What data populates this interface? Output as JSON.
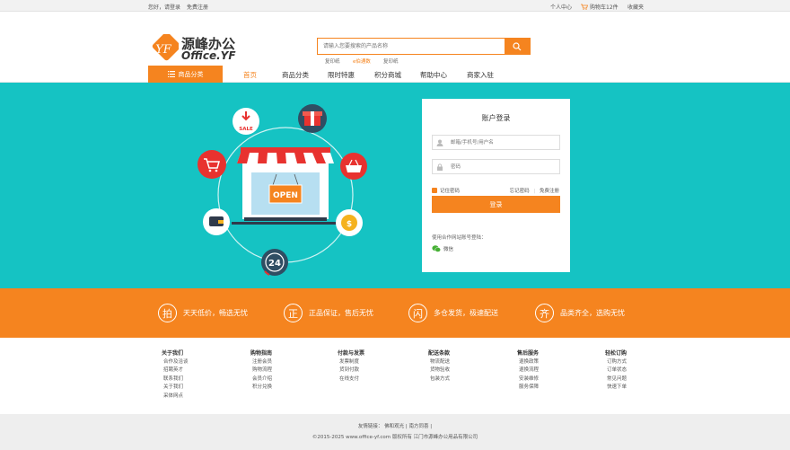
{
  "topbar": {
    "greeting": "您好，请登录",
    "register": "免费注册",
    "user_center": "个人中心",
    "cart": "购物车12件",
    "favorites": "收藏夹"
  },
  "logo": {
    "cn": "源峰办公",
    "en": "Office.YF"
  },
  "search": {
    "placeholder": "请输入您要搜索的产品名称",
    "hot": [
      "复印纸",
      "e伯通数",
      "复印纸"
    ]
  },
  "nav": {
    "category_button": "商品分类",
    "items": [
      "首页",
      "商品分类",
      "限时特惠",
      "积分商城",
      "帮助中心",
      "商家入驻"
    ]
  },
  "hero": {
    "sign_text": "OPEN",
    "badge_sale": "SALE",
    "badge_24": "24"
  },
  "login": {
    "title": "账户登录",
    "username_placeholder": "邮箱/手机号/用户名",
    "password_placeholder": "密码",
    "remember": "记住密码",
    "forgot": "忘记密码",
    "register": "免费注册",
    "submit": "登录",
    "other": "使用合作网站账号登陆：",
    "wechat": "微信"
  },
  "features": [
    {
      "icon": "拍",
      "text": "天天低价，畅选无忧"
    },
    {
      "icon": "正",
      "text": "正品保证，售后无忧"
    },
    {
      "icon": "闪",
      "text": "多仓发货，极速配送"
    },
    {
      "icon": "齐",
      "text": "品类齐全，选购无忧"
    }
  ],
  "footer_columns": [
    {
      "title": "关于我们",
      "items": [
        "合作及洽谈",
        "招聘英才",
        "联系我们",
        "关于我们",
        "采体网点"
      ]
    },
    {
      "title": "购物指南",
      "items": [
        "注册会员",
        "购物流程",
        "会员介绍",
        "积分兑换"
      ]
    },
    {
      "title": "付款与发票",
      "items": [
        "发票制度",
        "货到付款",
        "在线支付"
      ]
    },
    {
      "title": "配送条款",
      "items": [
        "物流配送",
        "货物验收",
        "包装方式"
      ]
    },
    {
      "title": "售后服务",
      "items": [
        "退换政策",
        "退换流程",
        "安装维修",
        "服务保障"
      ]
    },
    {
      "title": "轻松订购",
      "items": [
        "订购方式",
        "订单状态",
        "常见问题",
        "快速下单"
      ]
    }
  ],
  "bottom": {
    "friend_links": "友情链接： 佛和观光 | 南方同喜 |",
    "copyright": "©2015-2025 www.office-yf.com 版权所有 江门市源峰办公用品有限公司"
  },
  "colors": {
    "accent": "#f5841f",
    "hero_bg": "#15c3c3"
  }
}
